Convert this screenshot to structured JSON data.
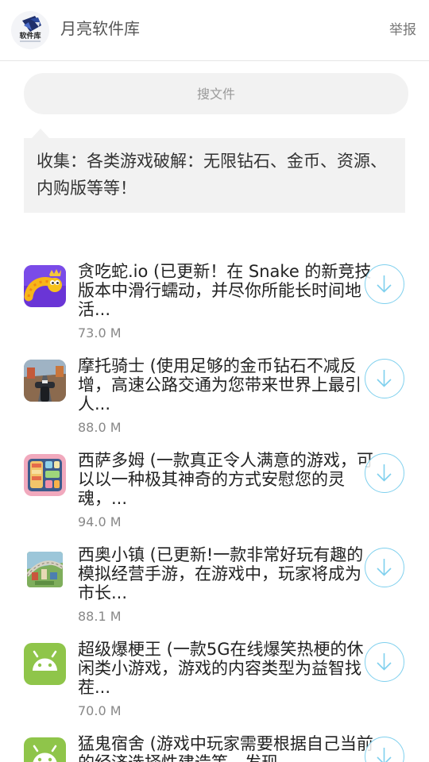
{
  "header": {
    "logo_text": "软件库",
    "title": "月亮软件库",
    "report_label": "举报"
  },
  "search": {
    "placeholder": "搜文件"
  },
  "notice": {
    "text": "收集：各类游戏破解：无限钻石、金币、资源、内购版等等！"
  },
  "colors": {
    "accent": "#7fd0ee",
    "panel": "#f2f2f2"
  },
  "files": [
    {
      "icon": "snake-game-icon",
      "description": "贪吃蛇.io (已更新！在 Snake 的新竞技版本中滑行蠕动，并尽你所能长时间地活...",
      "size": "73.0 M"
    },
    {
      "icon": "moto-rider-icon",
      "description": "摩托骑士 (使用足够的金币钻石不减反增，高速公路交通为您带来世界上最引人...",
      "size": "88.0 M"
    },
    {
      "icon": "xisadomu-game-icon",
      "description": "西萨多姆 (一款真正令人满意的游戏，可以以一种极其神奇的方式安慰您的灵魂，...",
      "size": "94.0 M"
    },
    {
      "icon": "town-game-icon",
      "description": "西奥小镇 (已更新!一款非常好玩有趣的模拟经营手游，在游戏中，玩家将成为市长...",
      "size": "88.1 M"
    },
    {
      "icon": "android-icon",
      "description": "超级爆梗王 (一款5G在线爆笑热梗的休闲类小游戏，游戏的内容类型为益智找茬...",
      "size": "70.0 M"
    },
    {
      "icon": "android-icon",
      "description": "猛鬼宿舍 (游戏中玩家需要根据自己当前的经济选择性建造等，发现",
      "size": ""
    }
  ]
}
